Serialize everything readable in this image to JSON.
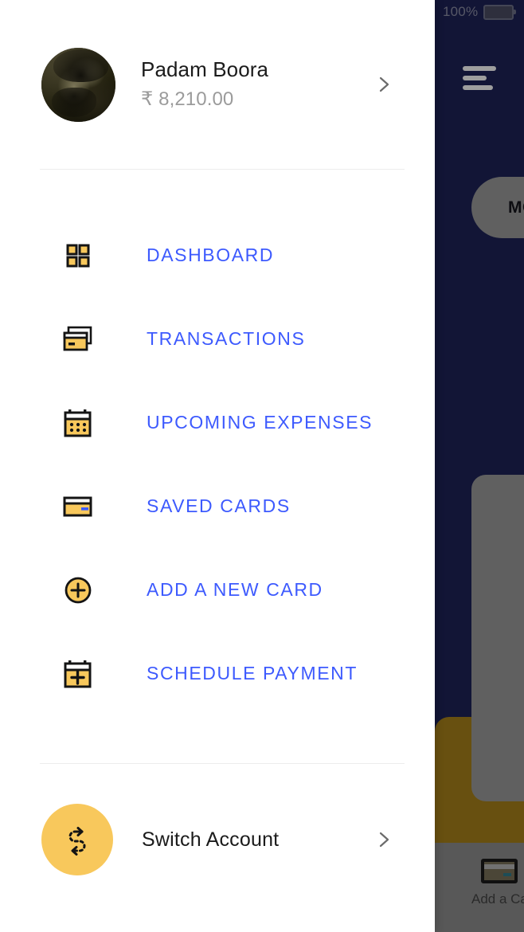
{
  "background_app": {
    "status_bar": {
      "battery_percent": "100%",
      "battery_icon": "battery-icon"
    },
    "menu_icon": "hamburger-icon",
    "month_pill_label": "MO",
    "bottom_tab": {
      "icon": "credit-card-icon",
      "label": "Add a Ca"
    },
    "colors": {
      "navy": "#1d2257",
      "olive": "#a8821a",
      "panel_gray": "#9c9c9c"
    }
  },
  "drawer": {
    "profile": {
      "avatar": "user-avatar-photo",
      "name": "Padam Boora",
      "balance": "₹ 8,210.00",
      "chevron": "chevron-right-icon"
    },
    "nav_items": [
      {
        "id": "dashboard",
        "label": "DASHBOARD",
        "icon": "grid-icon"
      },
      {
        "id": "transactions",
        "label": "TRANSACTIONS",
        "icon": "stacked-cards-icon"
      },
      {
        "id": "upcoming",
        "label": "UPCOMING EXPENSES",
        "icon": "calendar-dots-icon"
      },
      {
        "id": "saved-cards",
        "label": "SAVED CARDS",
        "icon": "credit-card-icon"
      },
      {
        "id": "add-new-card",
        "label": "ADD A NEW CARD",
        "icon": "plus-circle-icon"
      },
      {
        "id": "schedule-payment",
        "label": "SCHEDULE PAYMENT",
        "icon": "calendar-plus-icon"
      }
    ],
    "switch_account": {
      "label": "Switch Account",
      "icon": "swap-arrows-icon",
      "chevron": "chevron-right-icon"
    },
    "colors": {
      "accent_blue": "#3d5afe",
      "accent_yellow": "#f8c85c",
      "divider": "#ececec",
      "name_text": "#1b1b1b",
      "balance_text": "#9b9b9b"
    }
  }
}
